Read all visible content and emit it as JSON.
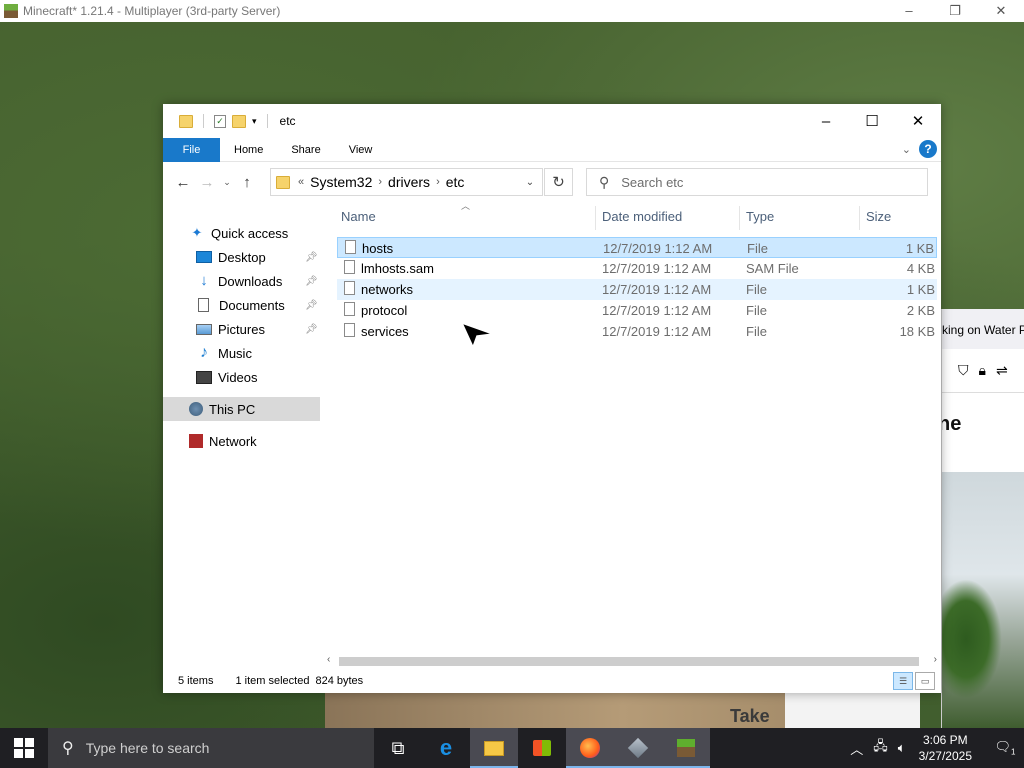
{
  "minecraft": {
    "title": "Minecraft* 1.21.4 - Multiplayer (3rd-party Server)",
    "controls": [
      "–",
      "❐",
      "✕"
    ],
    "sign_text": "Take"
  },
  "browser": {
    "tab_text": "king on Water P",
    "heading": "ne"
  },
  "explorer": {
    "title": "etc",
    "controls": [
      "–",
      "☐",
      "✕"
    ],
    "ribbon_tabs": [
      "File",
      "Home",
      "Share",
      "View"
    ],
    "help_label": "?",
    "address": {
      "overflow": "«",
      "crumbs": [
        "System32",
        "drivers",
        "etc"
      ]
    },
    "search_placeholder": "Search etc",
    "sidebar": [
      {
        "label": "Quick access",
        "icon": "star-icon",
        "pinned": false,
        "level": 1
      },
      {
        "label": "Desktop",
        "icon": "desktop-icon",
        "pinned": true,
        "level": 2
      },
      {
        "label": "Downloads",
        "icon": "download-icon",
        "pinned": true,
        "level": 2
      },
      {
        "label": "Documents",
        "icon": "document-icon",
        "pinned": true,
        "level": 2
      },
      {
        "label": "Pictures",
        "icon": "pictures-icon",
        "pinned": true,
        "level": 2
      },
      {
        "label": "Music",
        "icon": "music-icon",
        "pinned": false,
        "level": 2
      },
      {
        "label": "Videos",
        "icon": "video-icon",
        "pinned": false,
        "level": 2
      },
      {
        "label": "This PC",
        "icon": "computer-icon",
        "pinned": false,
        "level": 1
      },
      {
        "label": "Network",
        "icon": "network-icon",
        "pinned": false,
        "level": 1
      }
    ],
    "columns": [
      "Name",
      "Date modified",
      "Type",
      "Size"
    ],
    "files": [
      {
        "name": "hosts",
        "date": "12/7/2019 1:12 AM",
        "type": "File",
        "size": "1 KB",
        "state": "selected"
      },
      {
        "name": "lmhosts.sam",
        "date": "12/7/2019 1:12 AM",
        "type": "SAM File",
        "size": "4 KB",
        "state": ""
      },
      {
        "name": "networks",
        "date": "12/7/2019 1:12 AM",
        "type": "File",
        "size": "1 KB",
        "state": "hover"
      },
      {
        "name": "protocol",
        "date": "12/7/2019 1:12 AM",
        "type": "File",
        "size": "2 KB",
        "state": ""
      },
      {
        "name": "services",
        "date": "12/7/2019 1:12 AM",
        "type": "File",
        "size": "18 KB",
        "state": ""
      }
    ],
    "status": {
      "count": "5 items",
      "selection": "1 item selected",
      "bytes": "824 bytes"
    }
  },
  "taskbar": {
    "search_placeholder": "Type here to search",
    "time": "3:06 PM",
    "date": "3/27/2025",
    "notification_count": "1"
  },
  "colors": {
    "accent": "#1979ca",
    "selection": "#cce8ff",
    "taskbar": "#1f1f23"
  }
}
